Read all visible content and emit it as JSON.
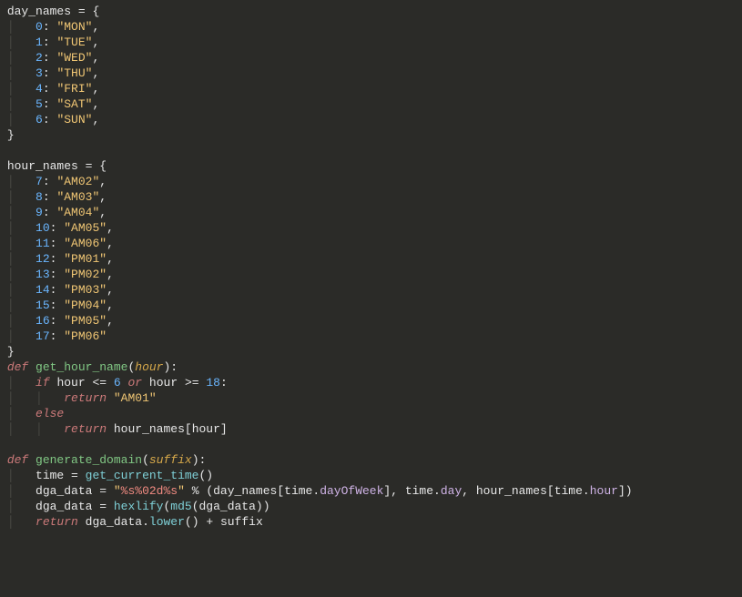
{
  "code": {
    "day_names_decl": {
      "name": "day_names",
      "eq": " = ",
      "open": "{"
    },
    "day_names": [
      {
        "key": "0",
        "val": "\"MON\""
      },
      {
        "key": "1",
        "val": "\"TUE\""
      },
      {
        "key": "2",
        "val": "\"WED\""
      },
      {
        "key": "3",
        "val": "\"THU\""
      },
      {
        "key": "4",
        "val": "\"FRI\""
      },
      {
        "key": "5",
        "val": "\"SAT\""
      },
      {
        "key": "6",
        "val": "\"SUN\""
      }
    ],
    "close_brace": "}",
    "hour_names_decl": {
      "name": "hour_names",
      "eq": " = ",
      "open": "{"
    },
    "hour_names": [
      {
        "key": "7",
        "val": "\"AM02\""
      },
      {
        "key": "8",
        "val": "\"AM03\""
      },
      {
        "key": "9",
        "val": "\"AM04\""
      },
      {
        "key": "10",
        "val": "\"AM05\""
      },
      {
        "key": "11",
        "val": "\"AM06\""
      },
      {
        "key": "12",
        "val": "\"PM01\""
      },
      {
        "key": "13",
        "val": "\"PM02\""
      },
      {
        "key": "14",
        "val": "\"PM03\""
      },
      {
        "key": "15",
        "val": "\"PM04\""
      },
      {
        "key": "16",
        "val": "\"PM05\""
      },
      {
        "key": "17",
        "val": "\"PM06\""
      }
    ],
    "func1": {
      "def": "def",
      "name": "get_hour_name",
      "lp": "(",
      "param": "hour",
      "rp": ")",
      "colon": ":",
      "if": "if",
      "cond_var": "hour",
      "le": " <= ",
      "six": "6",
      "or": " or ",
      "ge": " >= ",
      "eighteen": "18",
      "ret": "return",
      "am01": "\"AM01\"",
      "else": "else",
      "ret2": "return",
      "hn": "hour_names",
      "lb": "[",
      "hv": "hour",
      "rb": "]"
    },
    "func2": {
      "def": "def",
      "name": "generate_domain",
      "lp": "(",
      "param": "suffix",
      "rp": ")",
      "colon": ":",
      "l1": {
        "lhs": "time",
        "eq": " = ",
        "call": "get_current_time",
        "lp": "(",
        "rp": ")"
      },
      "l2": {
        "lhs": "dga_data",
        "eq": " = ",
        "q1": "\"",
        "f1": "%s%02d%s",
        "q2": "\"",
        "pct": " % ",
        "lp": "(",
        "dn": "day_names",
        "lb1": "[",
        "t1": "time",
        "dot1": ".",
        "a1": "dayOfWeek",
        "rb1": "]",
        "c1": ", ",
        "t2": "time",
        "dot2": ".",
        "a2": "day",
        "c2": ", ",
        "hn": "hour_names",
        "lb2": "[",
        "t3": "time",
        "dot3": ".",
        "a3": "hour",
        "rb2": "]",
        "rp": ")"
      },
      "l3": {
        "lhs": "dga_data",
        "eq": " = ",
        "hex": "hexlify",
        "lp": "(",
        "md5": "md5",
        "lp2": "(",
        "arg": "dga_data",
        "rp2": ")",
        "rp": ")"
      },
      "l4": {
        "ret": "return",
        "dd": "dga_data",
        "dot": ".",
        "lower": "lower",
        "lp": "(",
        "rp": ")",
        "plus": " + ",
        "suf": "suffix"
      }
    },
    "indent": {
      "guide": "│   ",
      "plain": "    "
    }
  }
}
